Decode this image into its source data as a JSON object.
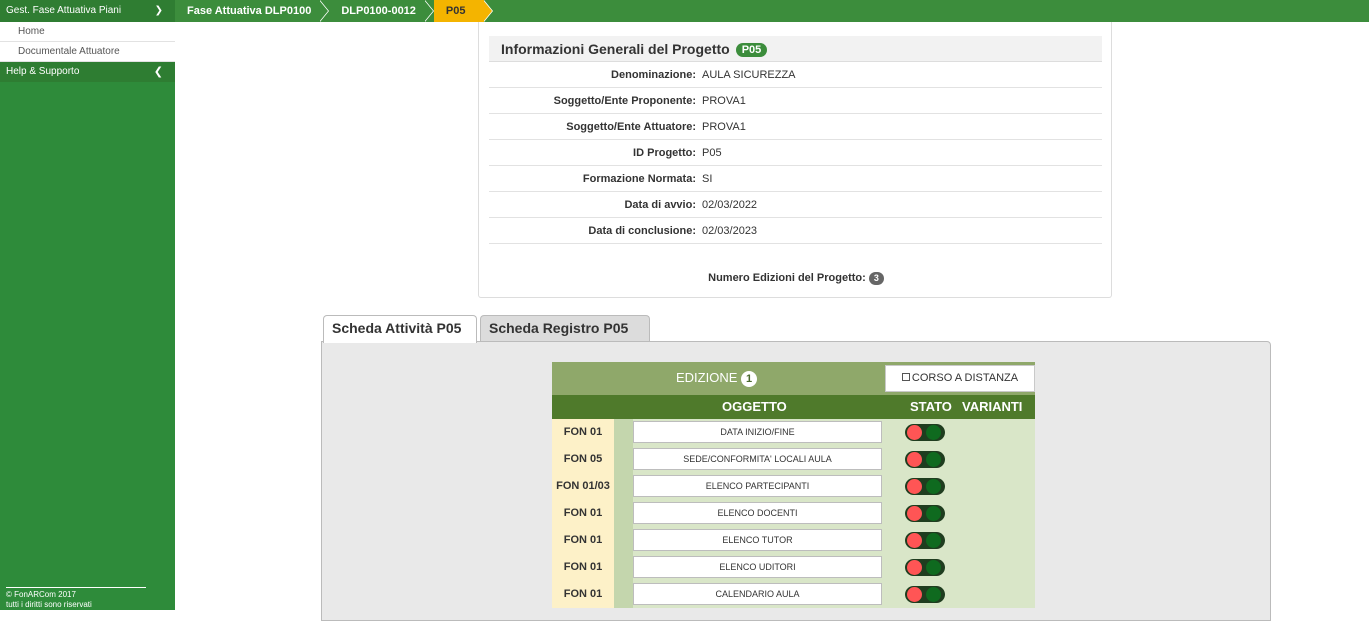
{
  "topbar": {
    "menu_label": "Gest. Fase Attuativa Piani",
    "crumbs": [
      "Fase Attuativa DLP0100",
      "DLP0100-0012",
      "P05"
    ]
  },
  "sidebar": {
    "items": [
      "Home",
      "Documentale Attuatore"
    ],
    "group": "Help & Supporto",
    "footer_line1": "© FonARCom 2017",
    "footer_line2": "tutti i diritti sono riservati"
  },
  "info": {
    "title": "Informazioni Generali del Progetto",
    "badge": "P05",
    "rows": [
      {
        "label": "Denominazione:",
        "value": "AULA SICUREZZA"
      },
      {
        "label": "Soggetto/Ente Proponente:",
        "value": "PROVA1"
      },
      {
        "label": "Soggetto/Ente Attuatore:",
        "value": "PROVA1"
      },
      {
        "label": "ID Progetto:",
        "value": "P05"
      },
      {
        "label": "Formazione Normata:",
        "value": "SI"
      },
      {
        "label": "Data di avvio:",
        "value": "02/03/2022"
      },
      {
        "label": "Data di conclusione:",
        "value": "02/03/2023"
      }
    ],
    "edizioni_label": "Numero Edizioni del Progetto:",
    "edizioni_count": "3"
  },
  "tabs": [
    "Scheda Attività P05",
    "Scheda Registro P05"
  ],
  "edition": {
    "title": "EDIZIONE",
    "number": "1",
    "distance_label": "CORSO A DISTANZA",
    "columns": [
      "OGGETTO",
      "STATO",
      "VARIANTI"
    ],
    "rows": [
      {
        "code": "FON 01",
        "object": "DATA INIZIO/FINE"
      },
      {
        "code": "FON 05",
        "object": "SEDE/CONFORMITA' LOCALI AULA"
      },
      {
        "code": "FON 01/03",
        "object": "ELENCO PARTECIPANTI"
      },
      {
        "code": "FON 01",
        "object": "ELENCO DOCENTI"
      },
      {
        "code": "FON 01",
        "object": "ELENCO TUTOR"
      },
      {
        "code": "FON 01",
        "object": "ELENCO UDITORI"
      },
      {
        "code": "FON 01",
        "object": "CALENDARIO AULA"
      }
    ]
  },
  "colors": {
    "brand_green": "#3c8d3c",
    "active_crumb": "#f4b400",
    "status_red": "#ff5555",
    "status_green": "#0f6a1f"
  }
}
